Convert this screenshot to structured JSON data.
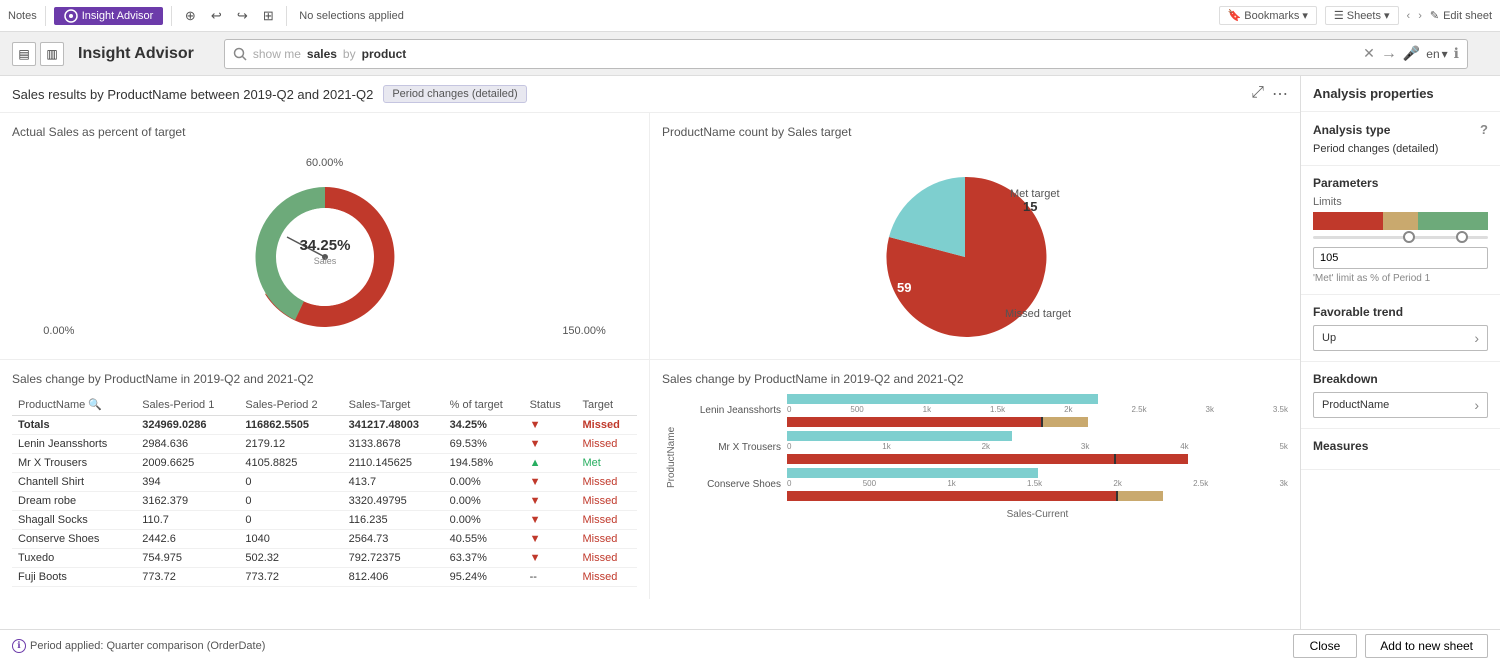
{
  "topbar": {
    "notes_label": "Notes",
    "insight_label": "Insight Advisor",
    "selections": "No selections applied",
    "bookmarks_label": "Bookmarks",
    "sheets_label": "Sheets",
    "edit_sheet_label": "Edit sheet"
  },
  "secondbar": {
    "ia_title": "Insight Advisor",
    "search_placeholder": "show me sales by product",
    "search_text_pre": "show me ",
    "search_bold": "sales",
    "search_text_mid": " by ",
    "search_bold2": "product",
    "lang": "en"
  },
  "results": {
    "title": "Sales results by ProductName between 2019-Q2 and 2021-Q2",
    "badge": "Period changes (detailed)"
  },
  "donut": {
    "title": "Actual Sales as percent of target",
    "pct": "34.25%",
    "sub": "Sales",
    "label_top": "60.00%",
    "label_left": "0.00%",
    "label_right": "150.00%"
  },
  "pie": {
    "title": "ProductName count by Sales target",
    "met_label": "Met target",
    "met_value": "15",
    "missed_label": "Missed target",
    "missed_value": "59"
  },
  "sales_table": {
    "title": "Sales change by ProductName in 2019-Q2 and 2021-Q2",
    "columns": [
      "ProductName",
      "Sales-Period 1",
      "Sales-Period 2",
      "Sales-Target",
      "% of target",
      "Status",
      "Target"
    ],
    "totals": {
      "name": "Totals",
      "period1": "324969.0286",
      "period2": "116862.5505",
      "target": "341217.48003",
      "pct": "34.25%",
      "trend": "▼",
      "status": "Missed"
    },
    "rows": [
      {
        "name": "Lenin Jeansshorts",
        "period1": "2984.636",
        "period2": "2179.12",
        "target": "3133.8678",
        "pct": "69.53%",
        "trend": "▼",
        "status": "Missed"
      },
      {
        "name": "Mr X Trousers",
        "period1": "2009.6625",
        "period2": "4105.8825",
        "target": "2110.145625",
        "pct": "194.58%",
        "trend": "▲",
        "status": "Met"
      },
      {
        "name": "Chantell Shirt",
        "period1": "394",
        "period2": "0",
        "target": "413.7",
        "pct": "0.00%",
        "trend": "▼",
        "status": "Missed"
      },
      {
        "name": "Dream robe",
        "period1": "3162.379",
        "period2": "0",
        "target": "3320.49795",
        "pct": "0.00%",
        "trend": "▼",
        "status": "Missed"
      },
      {
        "name": "Shagall Socks",
        "period1": "110.7",
        "period2": "0",
        "target": "116.235",
        "pct": "0.00%",
        "trend": "▼",
        "status": "Missed"
      },
      {
        "name": "Conserve Shoes",
        "period1": "2442.6",
        "period2": "1040",
        "target": "2564.73",
        "pct": "40.55%",
        "trend": "▼",
        "status": "Missed"
      },
      {
        "name": "Tuxedo",
        "period1": "754.975",
        "period2": "502.32",
        "target": "792.72375",
        "pct": "63.37%",
        "trend": "▼",
        "status": "Missed"
      },
      {
        "name": "Fuji Boots",
        "period1": "773.72",
        "period2": "773.72",
        "target": "812.406",
        "pct": "95.24%",
        "trend": "--",
        "status": "Missed"
      }
    ]
  },
  "bar_chart": {
    "title": "Sales change by ProductName in 2019-Q2 and 2021-Q2",
    "x_label": "Sales-Current",
    "y_label": "ProductName",
    "rows": [
      {
        "label": "Lenin Jeansshorts",
        "teal_w": 65,
        "red_w": 85
      },
      {
        "label": "Mr X Trousers",
        "teal_w": 40,
        "red_w": 75
      },
      {
        "label": "Conserve Shoes",
        "teal_w": 55,
        "red_w": 80
      }
    ],
    "x_ticks_top": [
      "0",
      "500",
      "1k",
      "1.5k",
      "2k",
      "2.5k",
      "3k",
      "3.5k"
    ],
    "x_ticks_mr": [
      "0",
      "1k",
      "2k",
      "3k",
      "4k",
      "5k"
    ],
    "x_ticks_cs": [
      "0",
      "500",
      "1k",
      "1.5k",
      "2k",
      "2.5k",
      "3k"
    ]
  },
  "right_panel": {
    "header": "Analysis properties",
    "analysis_type_label": "Analysis type",
    "analysis_type_value": "Period changes (detailed)",
    "parameters_label": "Parameters",
    "limits_label": "Limits",
    "input_value": "105",
    "input_note": "'Met' limit as % of Period 1",
    "favorable_label": "Favorable trend",
    "favorable_value": "Up",
    "breakdown_label": "Breakdown",
    "breakdown_value": "ProductName",
    "measures_label": "Measures"
  },
  "bottom": {
    "period_info": "Period applied:  Quarter comparison (OrderDate)",
    "close_btn": "Close",
    "add_btn": "Add to new sheet"
  }
}
